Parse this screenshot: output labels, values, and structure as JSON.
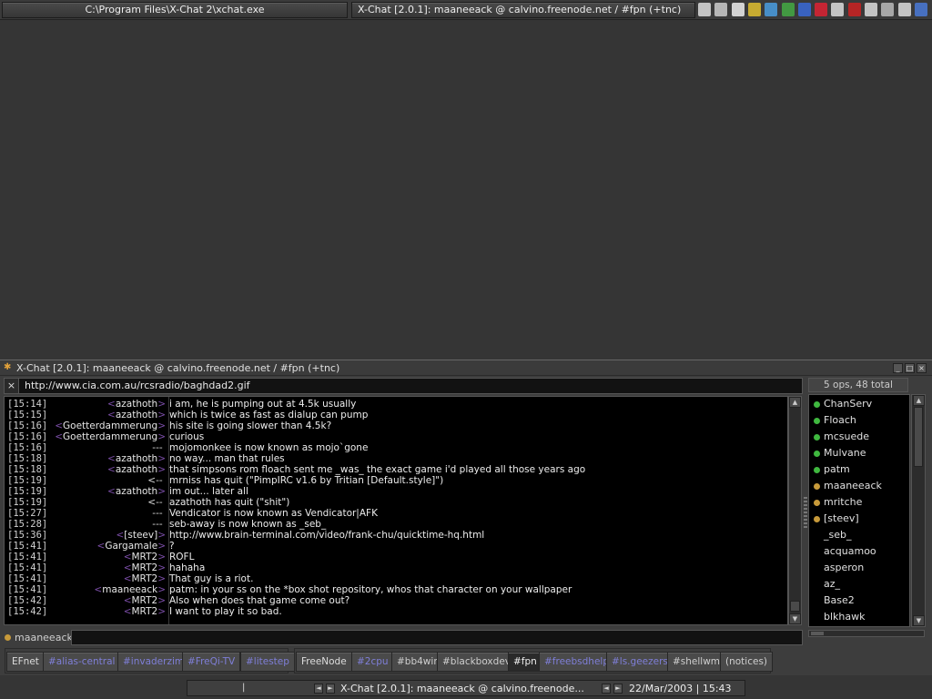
{
  "taskbar": {
    "task1": "C:\\Program Files\\X-Chat 2\\xchat.exe",
    "task2": "X-Chat [2.0.1]: maaneeack @ calvino.freenode.net / #fpn (+tnc)",
    "tray_icons": [
      "network-icon",
      "document-icon",
      "page-icon",
      "radiation-icon",
      "globe-icon",
      "recycle-icon",
      "globe-blue-icon",
      "book-icon",
      "eye-icon",
      "ati-icon",
      "speaker-icon",
      "monitor-icon",
      "network-alt-icon",
      "shield-icon"
    ]
  },
  "window": {
    "title": "X-Chat [2.0.1]: maaneeack @ calvino.freenode.net / #fpn (+tnc)",
    "topic": "http://www.cia.com.au/rcsradio/baghdad2.gif",
    "topic_close": "×",
    "user_count": "5 ops, 48 total",
    "nick": "maaneeack"
  },
  "chat": [
    {
      "ts": "[15:14]",
      "nick": "azathoth",
      "kind": "msg",
      "text": "i am, he is pumping out at 4.5k usually"
    },
    {
      "ts": "[15:15]",
      "nick": "azathoth",
      "kind": "msg",
      "text": "which is twice as fast as dialup can pump"
    },
    {
      "ts": "[15:16]",
      "nick": "Goetterdammerung",
      "kind": "msg",
      "text": "his site is going slower than 4.5k?"
    },
    {
      "ts": "[15:16]",
      "nick": "Goetterdammerung",
      "kind": "msg",
      "text": "curious"
    },
    {
      "ts": "[15:16]",
      "nick": "---",
      "kind": "event",
      "text": "mojomonkee is now known as mojo`gone"
    },
    {
      "ts": "[15:18]",
      "nick": "azathoth",
      "kind": "msg",
      "text": "no way... man that rules"
    },
    {
      "ts": "[15:18]",
      "nick": "azathoth",
      "kind": "msg",
      "text": "that simpsons rom floach sent me _was_ the exact game i'd played all those years ago"
    },
    {
      "ts": "[15:19]",
      "nick": "<--",
      "kind": "event",
      "text": "mrniss has quit (\"PimpIRC v1.6 by Tritian [Default.style]\")"
    },
    {
      "ts": "[15:19]",
      "nick": "azathoth",
      "kind": "msg",
      "text": "im out... later all"
    },
    {
      "ts": "[15:19]",
      "nick": "<--",
      "kind": "event",
      "text": "azathoth has quit (\"shit\")"
    },
    {
      "ts": "[15:27]",
      "nick": "---",
      "kind": "event",
      "text": "Vendicator is now known as Vendicator|AFK"
    },
    {
      "ts": "[15:28]",
      "nick": "---",
      "kind": "event",
      "text": "seb-away is now known as _seb_"
    },
    {
      "ts": "[15:36]",
      "nick": "[steev]",
      "kind": "msg",
      "text": "http://www.brain-terminal.com/video/frank-chu/quicktime-hq.html"
    },
    {
      "ts": "[15:41]",
      "nick": "Gargamale",
      "kind": "msg",
      "text": "?"
    },
    {
      "ts": "[15:41]",
      "nick": "MRT2",
      "kind": "msg",
      "text": "ROFL"
    },
    {
      "ts": "[15:41]",
      "nick": "MRT2",
      "kind": "msg",
      "text": "hahaha"
    },
    {
      "ts": "[15:41]",
      "nick": "MRT2",
      "kind": "msg",
      "text": "That guy is a riot."
    },
    {
      "ts": "[15:41]",
      "nick": "maaneeack",
      "kind": "msg",
      "text": "patm: in your ss on the *box shot repository, whos that character on your wallpaper"
    },
    {
      "ts": "[15:42]",
      "nick": "MRT2",
      "kind": "msg",
      "text": "Also when does that game come out?"
    },
    {
      "ts": "[15:42]",
      "nick": "MRT2",
      "kind": "msg",
      "text": "I want to play it so bad."
    }
  ],
  "users": [
    {
      "name": "ChanServ",
      "status": "op"
    },
    {
      "name": "Floach",
      "status": "op"
    },
    {
      "name": "mcsuede",
      "status": "op"
    },
    {
      "name": "Mulvane",
      "status": "op"
    },
    {
      "name": "patm",
      "status": "op"
    },
    {
      "name": "maaneeack",
      "status": "voice"
    },
    {
      "name": "mritche",
      "status": "voice"
    },
    {
      "name": "[steev]",
      "status": "voice"
    },
    {
      "name": "_seb_",
      "status": "none"
    },
    {
      "name": "acquamoo",
      "status": "none"
    },
    {
      "name": "asperon",
      "status": "none"
    },
    {
      "name": "az_",
      "status": "none"
    },
    {
      "name": "Base2",
      "status": "none"
    },
    {
      "name": "blkhawk",
      "status": "none"
    }
  ],
  "tabs_group1": [
    {
      "label": "EFnet",
      "type": "net"
    },
    {
      "label": "#alias-central",
      "type": "chan"
    },
    {
      "label": "#invaderzim",
      "type": "chan"
    },
    {
      "label": "#FreQi-TV",
      "type": "chan"
    },
    {
      "label": "#litestep",
      "type": "chan"
    }
  ],
  "tabs_group2": [
    {
      "label": "FreeNode",
      "type": "net"
    },
    {
      "label": "#2cpu",
      "type": "chan"
    },
    {
      "label": "#bb4win",
      "type": "plain"
    },
    {
      "label": "#blackboxdev",
      "type": "plain"
    },
    {
      "label": "#fpn",
      "type": "active"
    },
    {
      "label": "#freebsdhelp",
      "type": "chan"
    },
    {
      "label": "#ls.geezers",
      "type": "chan"
    },
    {
      "label": "#shellwm",
      "type": "plain"
    },
    {
      "label": "(notices)",
      "type": "plain"
    }
  ],
  "bottom_panel": {
    "separator": "|",
    "task": "X-Chat [2.0.1]: maaneeack @ calvino.freenode...",
    "clock": "22/Mar/2003 | 15:43"
  },
  "colors": {
    "op": "#3fb83f",
    "voice": "#c79a3a",
    "channel_tab": "#7f7fd8",
    "nick_bracket": "#7b4ea8"
  }
}
